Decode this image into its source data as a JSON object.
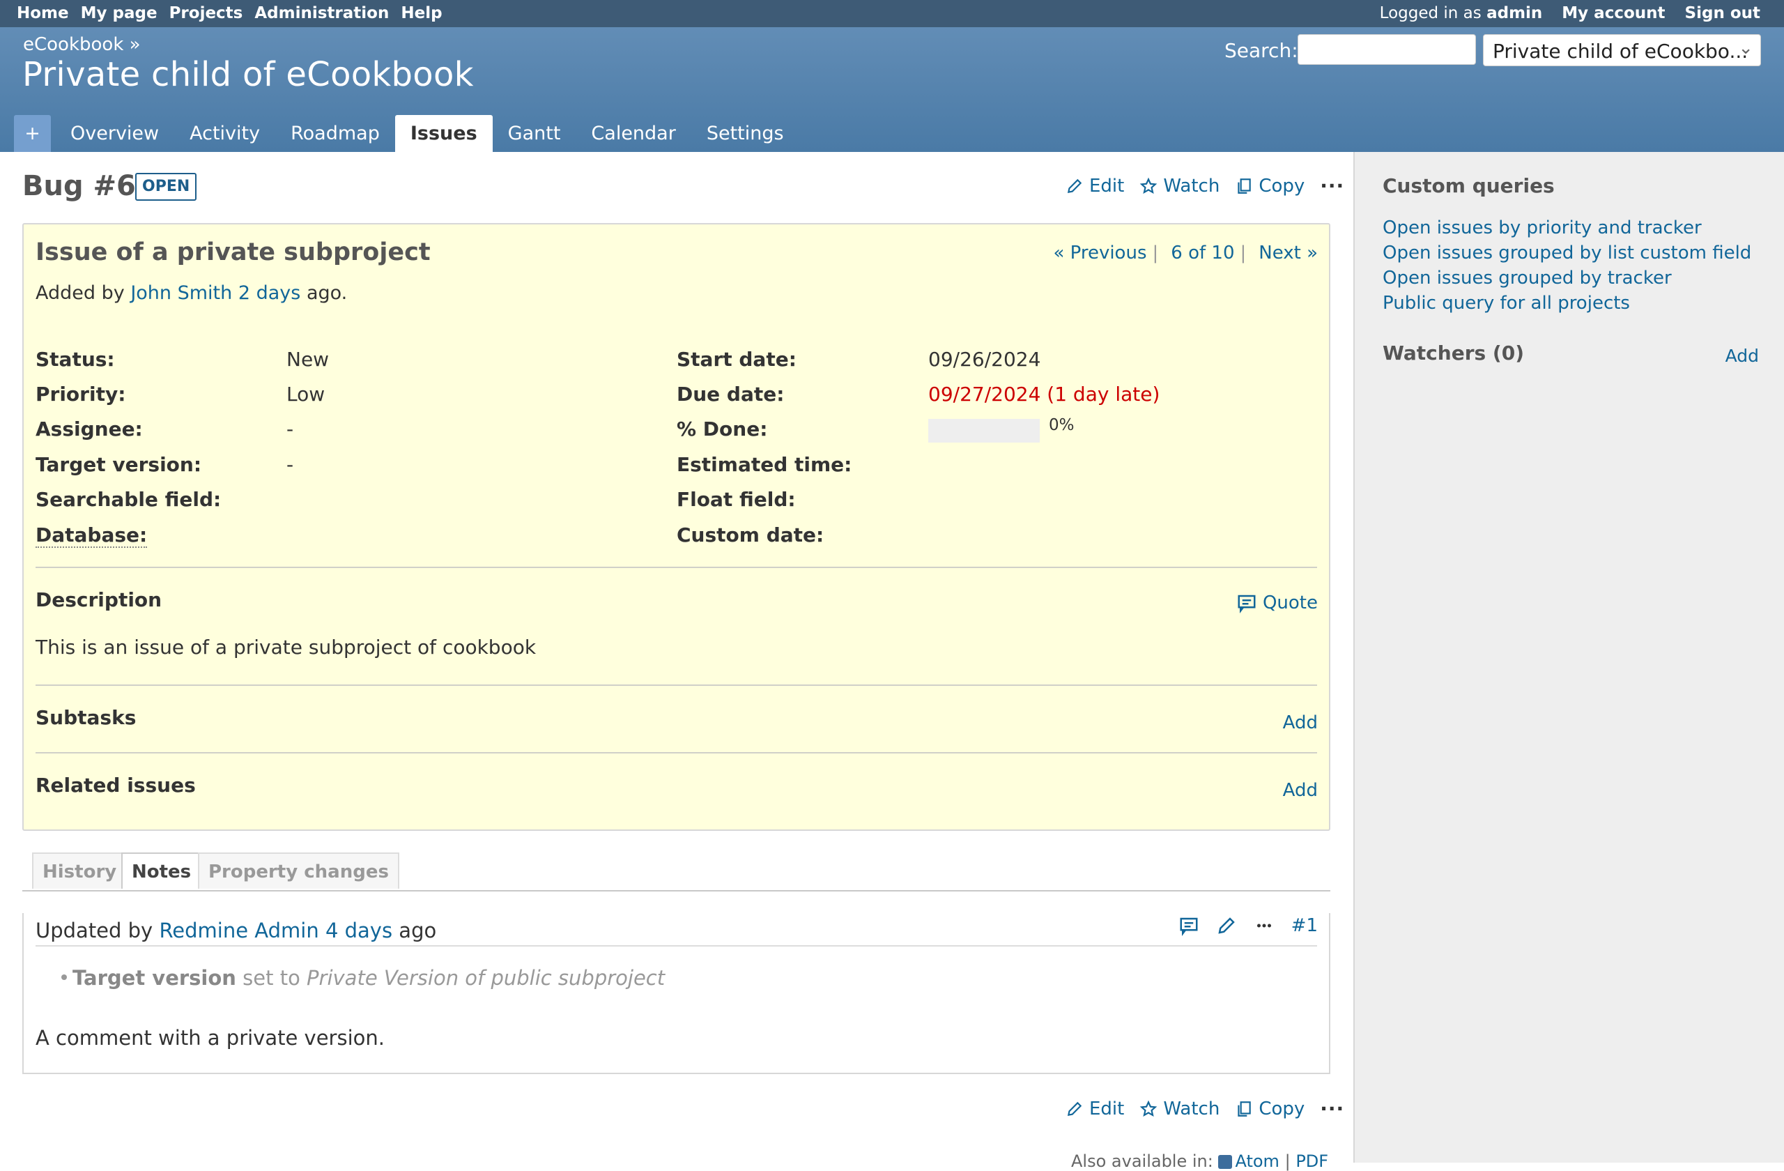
{
  "top_menu": {
    "left": [
      "Home",
      "My page",
      "Projects",
      "Administration",
      "Help"
    ],
    "logged_in_prefix": "Logged in as",
    "user": "admin",
    "my_account": "My account",
    "sign_out": "Sign out"
  },
  "header": {
    "breadcrumb": "eCookbook »",
    "title": "Private child of eCookbook",
    "search_label": "Search:",
    "project_jump": "Private child of eCookbo..."
  },
  "tabs": {
    "plus": "+",
    "items": [
      "Overview",
      "Activity",
      "Roadmap",
      "Issues",
      "Gantt",
      "Calendar",
      "Settings"
    ]
  },
  "issue": {
    "tracker_id": "Bug #6",
    "status_badge": "OPEN",
    "actions": {
      "edit": "Edit",
      "watch": "Watch",
      "copy": "Copy",
      "more": "···"
    },
    "subject": "Issue of a private subproject",
    "nav": {
      "previous": "« Previous",
      "position": "6 of 10",
      "next": "Next »",
      "sep": "|"
    },
    "added_by": {
      "prefix": "Added by",
      "author": "John Smith",
      "age": "2 days",
      "suffix": "ago."
    },
    "left_attrs": [
      {
        "label": "Status:",
        "value": "New"
      },
      {
        "label": "Priority:",
        "value": "Low"
      },
      {
        "label": "Assignee:",
        "value": "-"
      },
      {
        "label": "Target version:",
        "value": "-"
      },
      {
        "label": "Searchable field:",
        "value": ""
      },
      {
        "label": "Database:",
        "value": ""
      }
    ],
    "right_attrs": [
      {
        "label": "Start date:",
        "value": "09/26/2024"
      },
      {
        "label": "Due date:",
        "value": "09/27/2024 (1 day late)"
      },
      {
        "label": "% Done:",
        "value": "0%"
      },
      {
        "label": "Estimated time:",
        "value": ""
      },
      {
        "label": "Float field:",
        "value": ""
      },
      {
        "label": "Custom date:",
        "value": ""
      }
    ],
    "done_ratio": 0,
    "description_title": "Description",
    "quote": "Quote",
    "description": "This is an issue of a private subproject of cookbook",
    "subtasks_title": "Subtasks",
    "related_title": "Related issues",
    "add": "Add"
  },
  "history": {
    "tabs": [
      "History",
      "Notes",
      "Property changes"
    ],
    "selected": "Notes",
    "journal": {
      "prefix": "Updated by",
      "author": "Redmine Admin",
      "age": "4 days",
      "suffix": "ago",
      "number": "#1",
      "detail_field": "Target version",
      "detail_mid": "set to",
      "detail_value": "Private Version of public subproject",
      "note": "A comment with a private version."
    }
  },
  "sidebar": {
    "queries_title": "Custom queries",
    "queries": [
      "Open issues by priority and tracker",
      "Open issues grouped by list custom field",
      "Open issues grouped by tracker",
      "Public query for all projects"
    ],
    "watchers_title": "Watchers (0)",
    "watchers_add": "Add"
  },
  "footer": {
    "also_available": "Also available in:",
    "atom": "Atom",
    "sep": "|",
    "pdf": "PDF"
  },
  "colors": {
    "top_menu_bg": "#3e5b76",
    "header_bg": "#628db6",
    "issue_bg": "#ffffdd",
    "link": "#116699",
    "late": "#cc0000"
  }
}
